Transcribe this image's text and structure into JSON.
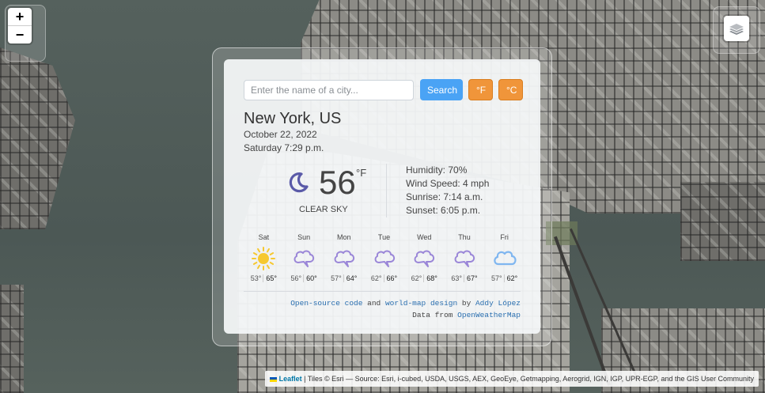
{
  "map": {
    "zoom_in_label": "+",
    "zoom_out_label": "−",
    "layers_icon": "layers-icon"
  },
  "attribution": {
    "leaflet_label": "Leaflet",
    "text": " | Tiles © Esri — Source: Esri, i-cubed, USDA, USGS, AEX, GeoEye, Getmapping, Aerogrid, IGN, IGP, UPR-EGP, and the GIS User Community"
  },
  "search": {
    "placeholder": "Enter the name of a city...",
    "value": "",
    "search_label": "Search",
    "fahrenheit_label": "°F",
    "celsius_label": "°C"
  },
  "location": {
    "city": "New York, US",
    "date": "October 22, 2022",
    "day_time": "Saturday 7:29 p.m."
  },
  "current": {
    "icon": "crescent-moon-icon",
    "temperature": "56",
    "unit": "°F",
    "condition": "CLEAR SKY",
    "humidity": "Humidity: 70%",
    "wind": "Wind Speed: 4 mph",
    "sunrise": "Sunrise: 7:14 a.m.",
    "sunset": "Sunset: 6:05 p.m."
  },
  "forecast": [
    {
      "day": "Sat",
      "icon": "sun-icon",
      "low": "53°",
      "high": "65°"
    },
    {
      "day": "Sun",
      "icon": "rain-cloud-icon",
      "low": "56°",
      "high": "60°"
    },
    {
      "day": "Mon",
      "icon": "rain-cloud-icon",
      "low": "57°",
      "high": "64°"
    },
    {
      "day": "Tue",
      "icon": "rain-cloud-icon",
      "low": "62°",
      "high": "66°"
    },
    {
      "day": "Wed",
      "icon": "rain-cloud-icon",
      "low": "62°",
      "high": "68°"
    },
    {
      "day": "Thu",
      "icon": "rain-cloud-icon",
      "low": "63°",
      "high": "67°"
    },
    {
      "day": "Fri",
      "icon": "cloud-icon",
      "low": "57°",
      "high": "62°"
    }
  ],
  "credits": {
    "open_source": "Open-source code",
    "and": " and ",
    "world_map": "world-map design",
    "by": " by ",
    "author": "Addy López",
    "data_from": "Data from ",
    "provider": "OpenWeatherMap"
  },
  "colors": {
    "search_button": "#4aa3f5",
    "unit_button": "#f0953a",
    "moon": "#5a5aa8",
    "sun": "#f6c830",
    "rain_cloud": "#9a86d8",
    "cloud": "#7fb6f0"
  }
}
